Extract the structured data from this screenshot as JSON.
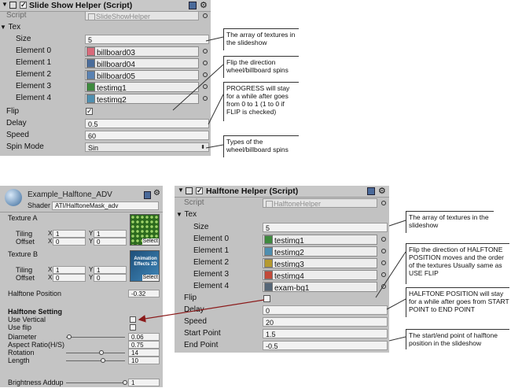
{
  "slideshow": {
    "title": "Slide Show Helper (Script)",
    "script_label": "Script",
    "script_value": "SlideShowHelper",
    "tex_label": "Tex",
    "size_label": "Size",
    "size_value": "5",
    "elements": [
      {
        "label": "Element 0",
        "value": "billboard03",
        "thumb": "#d86a7a"
      },
      {
        "label": "Element 1",
        "value": "billboard04",
        "thumb": "#4a6c9a"
      },
      {
        "label": "Element 2",
        "value": "billboard05",
        "thumb": "#5a82b2"
      },
      {
        "label": "Element 3",
        "value": "testimg1",
        "thumb": "#3e8a3e"
      },
      {
        "label": "Element 4",
        "value": "testimg2",
        "thumb": "#4f8fb0"
      }
    ],
    "flip_label": "Flip",
    "flip_mark": "✓",
    "delay_label": "Delay",
    "delay_value": "0.5",
    "speed_label": "Speed",
    "speed_value": "60",
    "spin_label": "Spin Mode",
    "spin_value": "Sin",
    "notes": [
      "The array of textures in the slideshow",
      "Flip the direction wheel/billboard spins",
      "PROGRESS will stay for a while after goes from 0 to 1 (1 to 0 if FLIP is checked)",
      "Types of the wheel/billboard spins"
    ]
  },
  "material": {
    "name": "Example_Halftone_ADV",
    "shader_label": "Shader",
    "shader_value": "ATI/HalftoneMask_adv",
    "texture_a_label": "Texture A",
    "texture_b_label": "Texture B",
    "tiling_label": "Tiling",
    "offset_label": "Offset",
    "x_label": "X",
    "y_label": "Y",
    "tex_a": {
      "tiling_x": "1",
      "tiling_y": "1",
      "offset_x": "0",
      "offset_y": "0"
    },
    "tex_b": {
      "tiling_x": "1",
      "tiling_y": "1",
      "offset_x": "0",
      "offset_y": "0"
    },
    "select_label": "Select",
    "tex_b_thumb_text": "Animation Effects 2D",
    "halftone_position_label": "Halftone Position",
    "halftone_position_value": "-0.32",
    "setting_header": "Halftone Setting",
    "use_vertical_label": "Use Vertical",
    "use_flip_label": "Use flip",
    "sliders": [
      {
        "label": "Diameter",
        "value": "0.06",
        "level": 0.05
      },
      {
        "label": "Aspect Ratio(H/S)",
        "value": "0.75",
        "level": null
      },
      {
        "label": "Rotation",
        "value": "14",
        "level": 0.6
      },
      {
        "label": "Length",
        "value": "10",
        "level": 0.62
      }
    ],
    "brightness_label": "Brightness Addup",
    "brightness_value": "1",
    "brightness_level": 1.0
  },
  "halftone": {
    "title": "Halftone Helper (Script)",
    "script_label": "Script",
    "script_value": "HalftoneHelper",
    "tex_label": "Tex",
    "size_label": "Size",
    "size_value": "5",
    "elements": [
      {
        "label": "Element 0",
        "value": "testimg1",
        "thumb": "#3e8a3e"
      },
      {
        "label": "Element 1",
        "value": "testimg2",
        "thumb": "#4f8fb0"
      },
      {
        "label": "Element 2",
        "value": "testimg3",
        "thumb": "#b59a30"
      },
      {
        "label": "Element 3",
        "value": "testimg4",
        "thumb": "#c24a3a"
      },
      {
        "label": "Element 4",
        "value": "exam-bg1",
        "thumb": "#556677"
      }
    ],
    "flip_label": "Flip",
    "delay_label": "Delay",
    "delay_value": "0",
    "speed_label": "Speed",
    "speed_value": "20",
    "start_label": "Start Point",
    "start_value": "1.5",
    "end_label": "End Point",
    "end_value": "-0.5",
    "notes": [
      "The array of textures in the slideshow",
      "Flip the direction of HALFTONE POSITION moves and the order of the textures Usually same as USE FLIP",
      "HALFTONE POSITION will stay for a while after goes from START POINT to END POINT",
      "The start/end point of halftone position in the slideshow"
    ]
  }
}
